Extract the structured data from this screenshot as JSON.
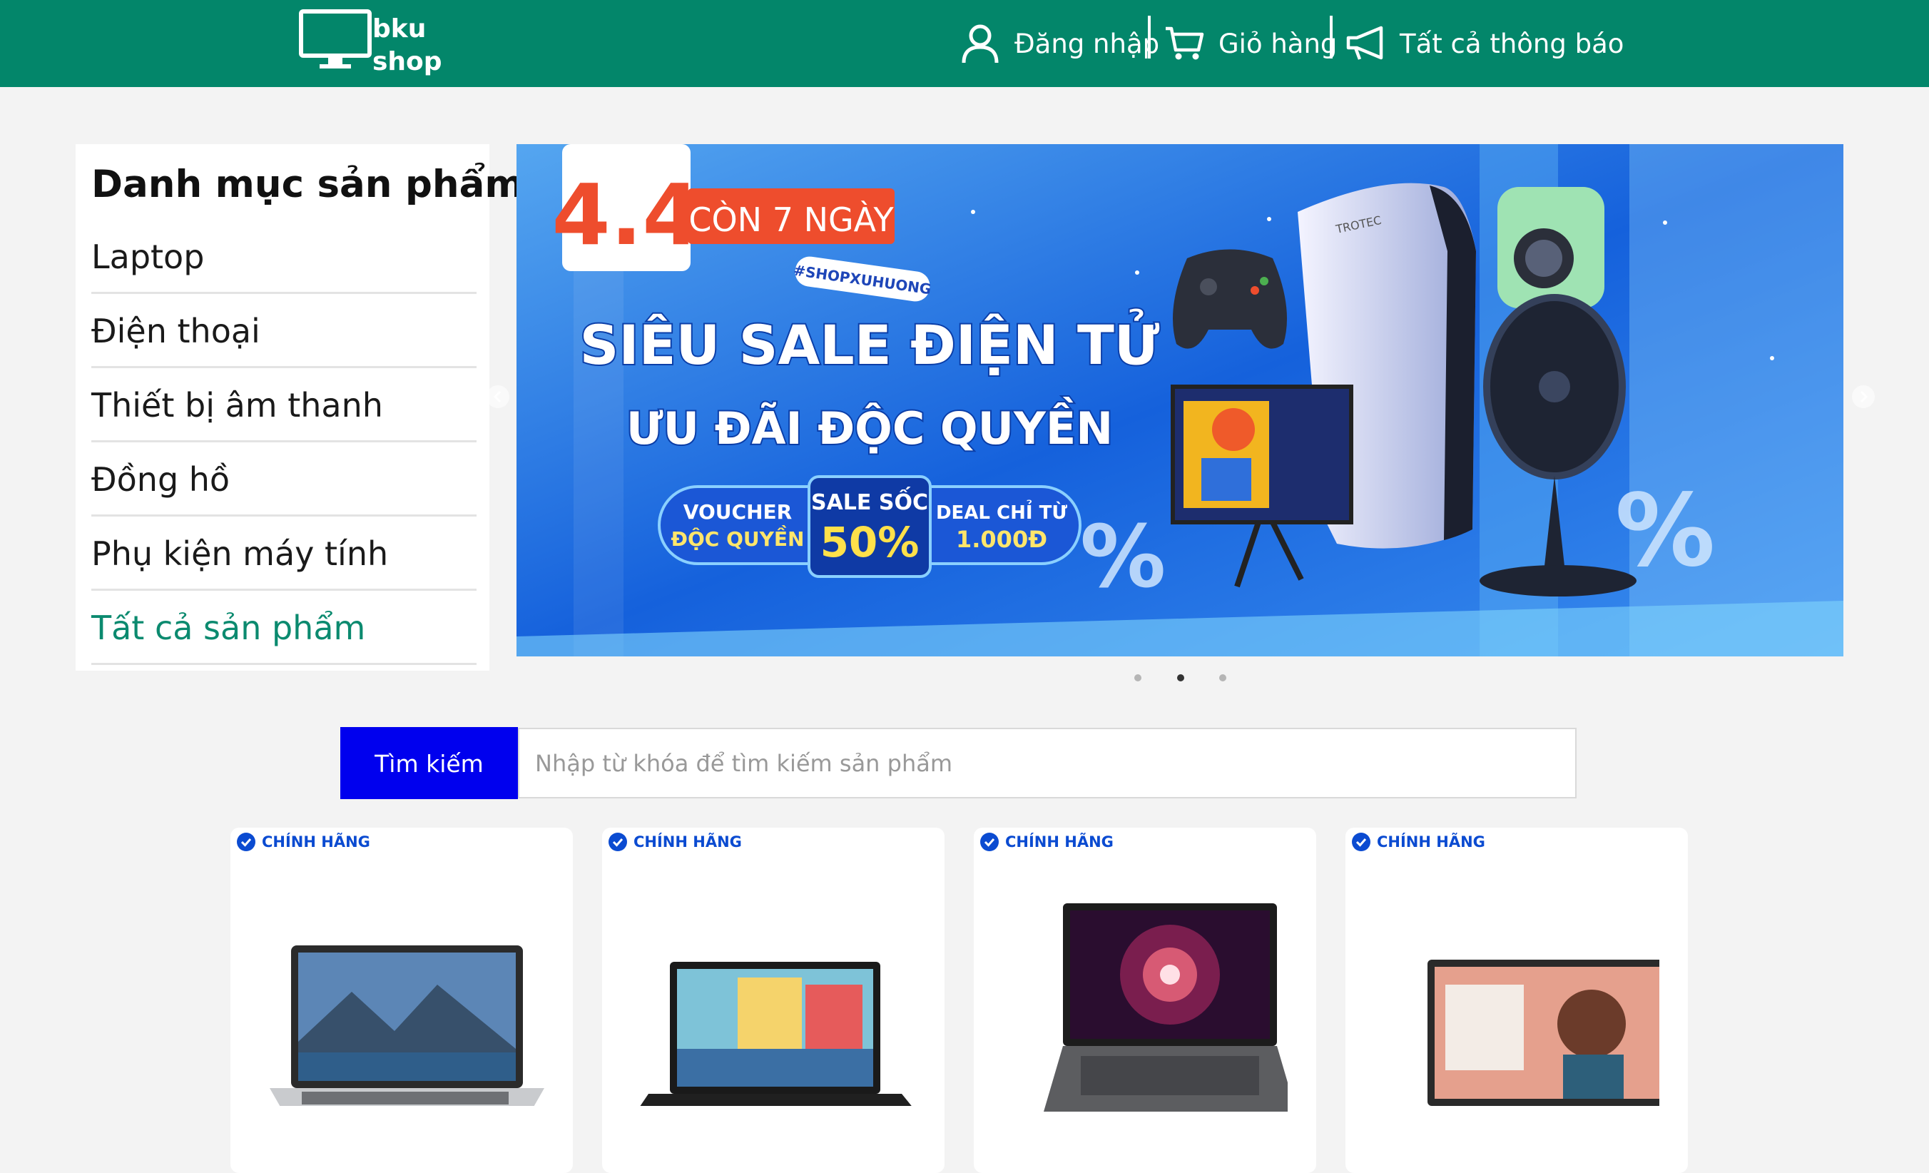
{
  "logo": {
    "line1": "bku",
    "line2": "shop"
  },
  "nav": {
    "login": "Đăng nhập",
    "cart": "Giỏ hàng",
    "notifications": "Tất cả thông báo"
  },
  "sidebar": {
    "title": "Danh mục sản phẩm",
    "items": [
      {
        "label": "Laptop"
      },
      {
        "label": "Điện thoại"
      },
      {
        "label": "Thiết bị âm thanh"
      },
      {
        "label": "Đồng hồ"
      },
      {
        "label": "Phụ kiện máy tính"
      },
      {
        "label": "Tất cả sản phẩm"
      }
    ]
  },
  "banner": {
    "date": "4.4",
    "countdown": "CÒN 7 NGÀY",
    "hashtag": "#SHOPXUHUONG",
    "headline": "SIÊU SALE ĐIỆN TỬ",
    "subheadline": "ƯU ĐÃI ĐỘC QUYỀN",
    "voucher_line1": "VOUCHER",
    "voucher_line2": "ĐỘC QUYỀN",
    "sale_label": "SALE SỐC",
    "sale_value": "50%",
    "deal_line1": "DEAL CHỈ TỪ",
    "deal_line2": "1.000Đ",
    "brand": "TROTEC",
    "slide_count": 3,
    "active_slide": 2
  },
  "search": {
    "button": "Tìm kiếm",
    "placeholder": "Nhập từ khóa để tìm kiếm sản phẩm",
    "value": ""
  },
  "products": [
    {
      "badge": "CHÍNH HÃNG"
    },
    {
      "badge": "CHÍNH HÃNG"
    },
    {
      "badge": "CHÍNH HÃNG"
    },
    {
      "badge": "CHÍNH HÃNG"
    }
  ],
  "colors": {
    "header": "#03866a",
    "search_button": "#0000ee",
    "accent_link": "#0b8a6f",
    "badge": "#0b4bd1"
  }
}
